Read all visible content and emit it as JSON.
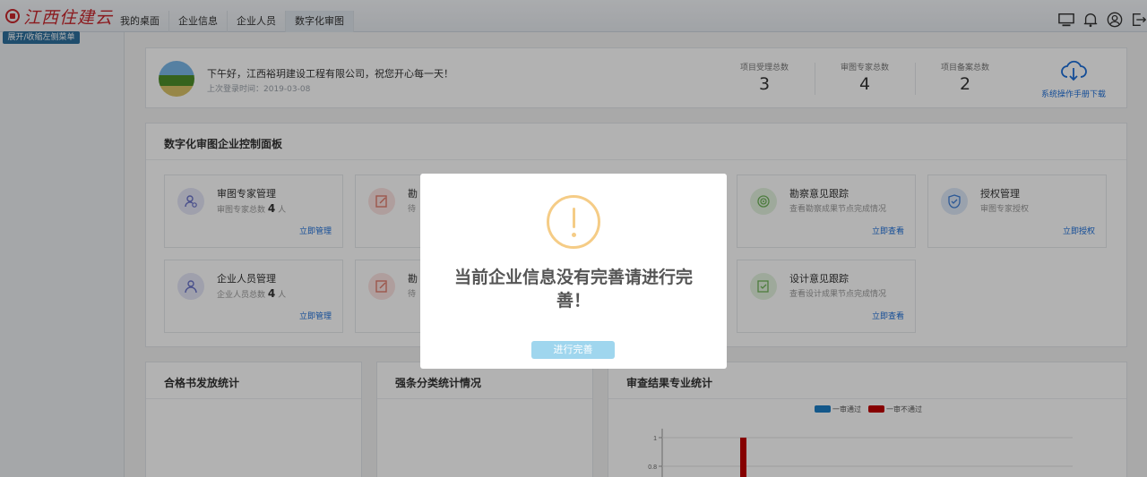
{
  "brand": {
    "name": "江西住建云"
  },
  "collapse_label": "展开/收缩左侧菜单",
  "tabs": [
    {
      "label": "我的桌面"
    },
    {
      "label": "企业信息"
    },
    {
      "label": "企业人员"
    },
    {
      "label": "数字化审图"
    }
  ],
  "top_icons": [
    "monitor-icon",
    "bell-icon",
    "user-circle-icon",
    "logout-icon"
  ],
  "welcome": {
    "greeting": "下午好，江西裕玥建设工程有限公司，祝您开心每一天！",
    "last_login": "上次登录时间：2019-03-08",
    "stats": [
      {
        "label": "项目受理总数",
        "value": "3"
      },
      {
        "label": "审图专家总数",
        "value": "4"
      },
      {
        "label": "项目备案总数",
        "value": "2"
      }
    ],
    "manual_label": "系统操作手册下载"
  },
  "panel": {
    "title": "数字化审图企业控制面板",
    "modules": [
      {
        "title": "审图专家管理",
        "sub_prefix": "审图专家总数",
        "count": "4",
        "sub_suffix": "人",
        "link": "立即管理",
        "icon": "expert-user-icon"
      },
      {
        "title": "勘",
        "sub_prefix": "待",
        "count": "",
        "sub_suffix": "",
        "link": "",
        "icon": "edit-doc-icon"
      },
      {
        "title": "勘察意见跟踪",
        "sub_prefix": "查看勘察成果节点完成情况",
        "count": "",
        "sub_suffix": "",
        "link": "立即查看",
        "icon": "target-icon"
      },
      {
        "title": "授权管理",
        "sub_prefix": "审图专家授权",
        "count": "",
        "sub_suffix": "",
        "link": "立即授权",
        "icon": "shield-check-icon"
      },
      {
        "title": "企业人员管理",
        "sub_prefix": "企业人员总数",
        "count": "4",
        "sub_suffix": "人",
        "link": "立即管理",
        "icon": "person-icon"
      },
      {
        "title": "勘",
        "sub_prefix": "待",
        "count": "",
        "sub_suffix": "",
        "link": "",
        "icon": "edit-doc-icon"
      },
      {
        "title": "设计意见跟踪",
        "sub_prefix": "查看设计成果节点完成情况",
        "count": "",
        "sub_suffix": "",
        "link": "立即查看",
        "icon": "edit-check-icon"
      }
    ]
  },
  "stat_cards": [
    {
      "title": "合格书发放统计"
    },
    {
      "title": "强条分类统计情况"
    },
    {
      "title": "审查结果专业统计"
    }
  ],
  "chart_data": {
    "type": "bar",
    "title": "",
    "series": [
      {
        "name": "一审通过",
        "color": "#1e7fc6"
      },
      {
        "name": "一审不通过",
        "color": "#c00000"
      }
    ],
    "ytick_labels": [
      "1",
      "0.8"
    ],
    "values_visible": {
      "一审不通过": 1
    },
    "legend": "top-center"
  },
  "dialog": {
    "message": "当前企业信息没有完善请进行完善！",
    "button": "进行完善",
    "icon": "warning-icon",
    "accent": "#f5cc86"
  }
}
